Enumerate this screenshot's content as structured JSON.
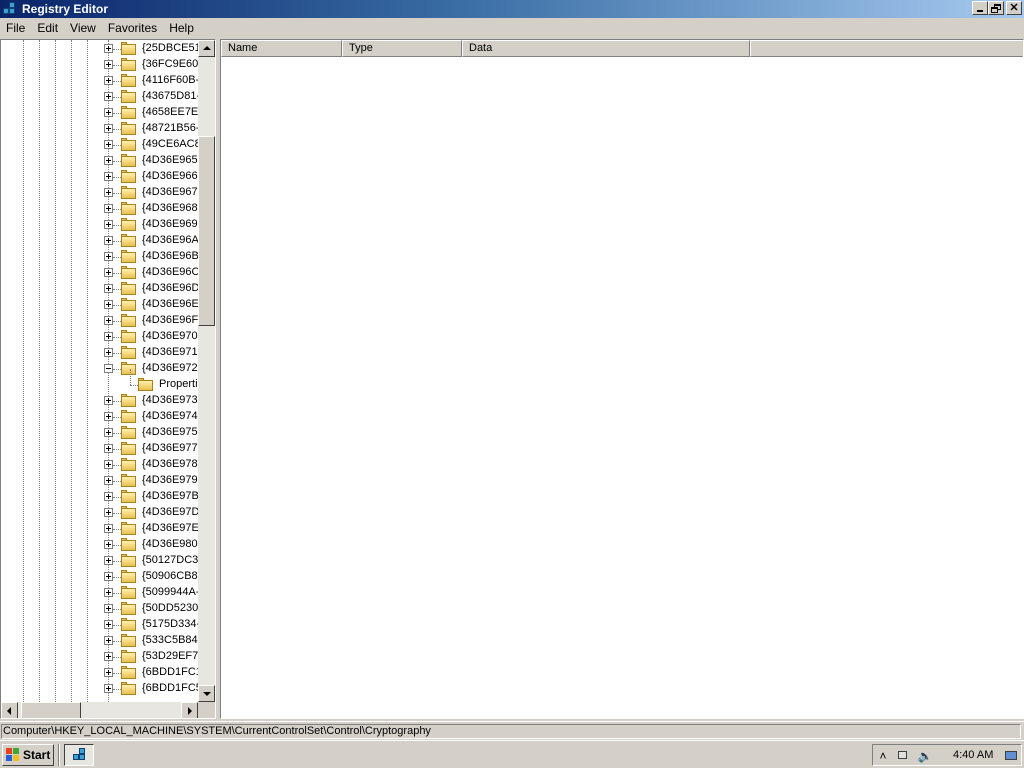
{
  "window": {
    "title": "Registry Editor"
  },
  "menu": [
    "File",
    "Edit",
    "View",
    "Favorites",
    "Help"
  ],
  "tree": {
    "items": [
      {
        "label": "{25DBCE51-",
        "state": "collapsed"
      },
      {
        "label": "{36FC9E60-",
        "state": "collapsed"
      },
      {
        "label": "{4116F60B-",
        "state": "collapsed"
      },
      {
        "label": "{43675D81-",
        "state": "collapsed"
      },
      {
        "label": "{4658EE7E-",
        "state": "collapsed"
      },
      {
        "label": "{48721B56-",
        "state": "collapsed"
      },
      {
        "label": "{49CE6AC8-",
        "state": "collapsed"
      },
      {
        "label": "{4D36E965-",
        "state": "collapsed"
      },
      {
        "label": "{4D36E966-",
        "state": "collapsed"
      },
      {
        "label": "{4D36E967-",
        "state": "collapsed"
      },
      {
        "label": "{4D36E968-",
        "state": "collapsed"
      },
      {
        "label": "{4D36E969-",
        "state": "collapsed"
      },
      {
        "label": "{4D36E96A-",
        "state": "collapsed"
      },
      {
        "label": "{4D36E96B-",
        "state": "collapsed"
      },
      {
        "label": "{4D36E96C-",
        "state": "collapsed"
      },
      {
        "label": "{4D36E96D-",
        "state": "collapsed"
      },
      {
        "label": "{4D36E96E-",
        "state": "collapsed"
      },
      {
        "label": "{4D36E96F-",
        "state": "collapsed"
      },
      {
        "label": "{4D36E970-",
        "state": "collapsed"
      },
      {
        "label": "{4D36E971-",
        "state": "collapsed"
      },
      {
        "label": "{4D36E972-",
        "state": "expanded"
      },
      {
        "label": "Properti",
        "state": "child"
      },
      {
        "label": "{4D36E973-",
        "state": "collapsed"
      },
      {
        "label": "{4D36E974-",
        "state": "collapsed"
      },
      {
        "label": "{4D36E975-",
        "state": "collapsed"
      },
      {
        "label": "{4D36E977-",
        "state": "collapsed"
      },
      {
        "label": "{4D36E978-",
        "state": "collapsed"
      },
      {
        "label": "{4D36E979-",
        "state": "collapsed"
      },
      {
        "label": "{4D36E97B-",
        "state": "collapsed"
      },
      {
        "label": "{4D36E97D-",
        "state": "collapsed"
      },
      {
        "label": "{4D36E97E-",
        "state": "collapsed"
      },
      {
        "label": "{4D36E980-",
        "state": "collapsed"
      },
      {
        "label": "{50127DC3-",
        "state": "collapsed"
      },
      {
        "label": "{50906CB8-",
        "state": "collapsed"
      },
      {
        "label": "{5099944A-",
        "state": "collapsed"
      },
      {
        "label": "{50DD5230-",
        "state": "collapsed"
      },
      {
        "label": "{5175D334-",
        "state": "collapsed"
      },
      {
        "label": "{533C5B84-",
        "state": "collapsed"
      },
      {
        "label": "{53D29EF7-",
        "state": "collapsed"
      },
      {
        "label": "{6BDD1FC1-",
        "state": "collapsed"
      },
      {
        "label": "{6BDD1FC5-",
        "state": "collapsed"
      }
    ]
  },
  "list": {
    "columns": [
      "Name",
      "Type",
      "Data"
    ]
  },
  "status": {
    "path": "Computer\\HKEY_LOCAL_MACHINE\\SYSTEM\\CurrentControlSet\\Control\\Cryptography"
  },
  "taskbar": {
    "start_label": "Start",
    "clock": "4:40 AM"
  },
  "colors": {
    "titlebar_start": "#0a246a",
    "titlebar_end": "#a6caf0",
    "face": "#d4d0c8",
    "folder": "#e8c050"
  },
  "icons": [
    "registry-icon",
    "minimize-icon",
    "restore-icon",
    "close-icon",
    "folder-icon",
    "windows-logo-icon",
    "tray-chevron-icon",
    "network-icon",
    "volume-icon",
    "monitor-icon"
  ]
}
